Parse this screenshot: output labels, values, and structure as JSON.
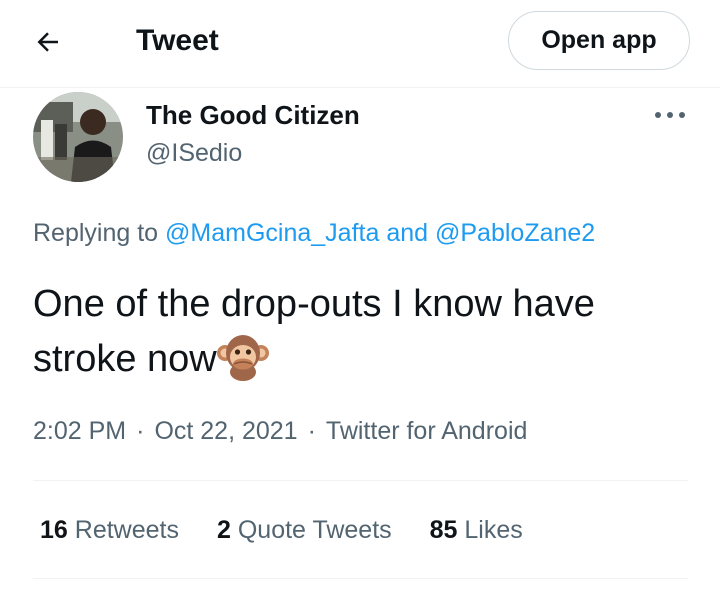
{
  "header": {
    "back_icon": "arrow-left-icon",
    "title": "Tweet",
    "open_app_label": "Open app"
  },
  "tweet": {
    "author": {
      "display_name": "The Good Citizen",
      "handle": "@ISedio",
      "avatar": "avatar-photo"
    },
    "more_icon": "more-dots-icon",
    "reply_prefix": "Replying to",
    "reply_to": [
      "@MamGcina_Jafta",
      "@PabloZane2"
    ],
    "reply_joiner": "and",
    "text_line1": "One of the drop-outs I know have",
    "text_line2": "stroke now",
    "emoji": "speak-no-evil-monkey-emoji",
    "time": "2:02 PM",
    "date": "Oct 22, 2021",
    "separator": "·",
    "source": "Twitter for Android",
    "stats": {
      "retweets_count": "16",
      "retweets_label": "Retweets",
      "quotes_count": "2",
      "quotes_label": "Quote Tweets",
      "likes_count": "85",
      "likes_label": "Likes"
    }
  },
  "colors": {
    "text": "#0f1419",
    "secondary": "#536471",
    "link": "#1d9bf0",
    "border": "#eff3f4"
  }
}
